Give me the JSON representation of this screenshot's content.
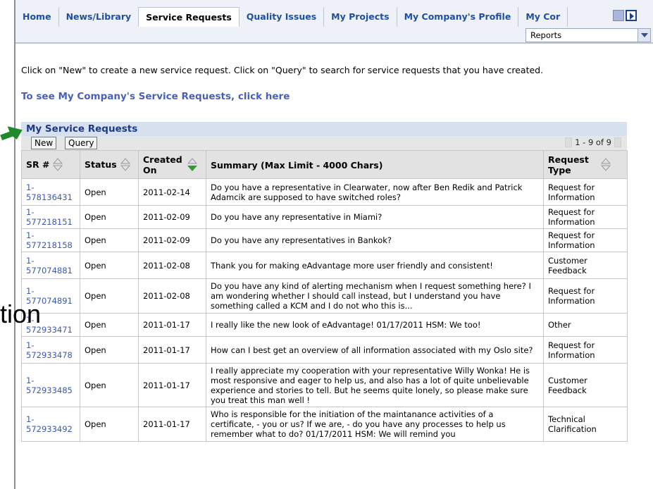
{
  "nav": {
    "tabs": [
      {
        "label": "Home",
        "active": false
      },
      {
        "label": "News/Library",
        "active": false
      },
      {
        "label": "Service Requests",
        "active": true
      },
      {
        "label": "Quality Issues",
        "active": false
      },
      {
        "label": "My Projects",
        "active": false
      },
      {
        "label": "My Company's Profile",
        "active": false
      },
      {
        "label": "My Cor",
        "active": false
      }
    ],
    "dropdown_value": "Reports"
  },
  "intro_text": "Click on \"New\" to create a new service request. Click on \"Query\" to search for service requests that you have created.",
  "company_link": "To see My Company's Service Requests, click here",
  "overlay_text": "tion",
  "panel": {
    "title": "My Service Requests",
    "new_label": "New",
    "query_label": "Query",
    "pager": "1 - 9 of 9"
  },
  "table": {
    "headers": [
      "SR #",
      "Status",
      "Created On",
      "Summary (Max Limit - 4000 Chars)",
      "Request Type"
    ],
    "rows": [
      [
        "1-578136431",
        "Open",
        "2011-02-14",
        "Do you have a representative in Clearwater, now after Ben Redik and Patrick Adamcik are supposed to have switched roles?",
        "Request for Information"
      ],
      [
        "1-577218151",
        "Open",
        "2011-02-09",
        "Do you have any representative in Miami?",
        "Request for Information"
      ],
      [
        "1-577218158",
        "Open",
        "2011-02-09",
        "Do you have any representatives in Bankok?",
        "Request for Information"
      ],
      [
        "1-577074881",
        "Open",
        "2011-02-08",
        "Thank you for making eAdvantage more user friendly and consistent!",
        "Customer Feedback"
      ],
      [
        "1-577074891",
        "Open",
        "2011-02-08",
        "Do you have any kind of alerting mechanism when I request something here? I am wondering whether I should call instead, but I understand you have something called a KCM and I do not who this is...",
        "Request for Information"
      ],
      [
        "1-572933471",
        "Open",
        "2011-01-17",
        "I really like the new look of eAdvantage! 01/17/2011 HSM: We too!",
        "Other"
      ],
      [
        "1-572933478",
        "Open",
        "2011-01-17",
        "How can I best get an overview of all information associated with my Oslo site?",
        "Request for Information"
      ],
      [
        "1-572933485",
        "Open",
        "2011-01-17",
        "I really appreciate my cooperation with your representative Willy Wonka! He is most responsive and eager to help us, and also has a lot of quite unbelievable experience and stories to tell. But he seems quite lonely, so please make sure you treat this man well !",
        "Customer Feedback"
      ],
      [
        "1-572933492",
        "Open",
        "2011-01-17",
        "Who is responsible for the initiation of the maintanance activities of a certificate, - you or us? If we are, - do you have any processes to help us remember what to do? 01/17/2011 HSM: We will remind you",
        "Technical Clarification"
      ]
    ]
  },
  "colors": {
    "accent_link": "#3b58b3",
    "header_bg": "#d6e0ee",
    "arrow": "#1f8a2b"
  }
}
